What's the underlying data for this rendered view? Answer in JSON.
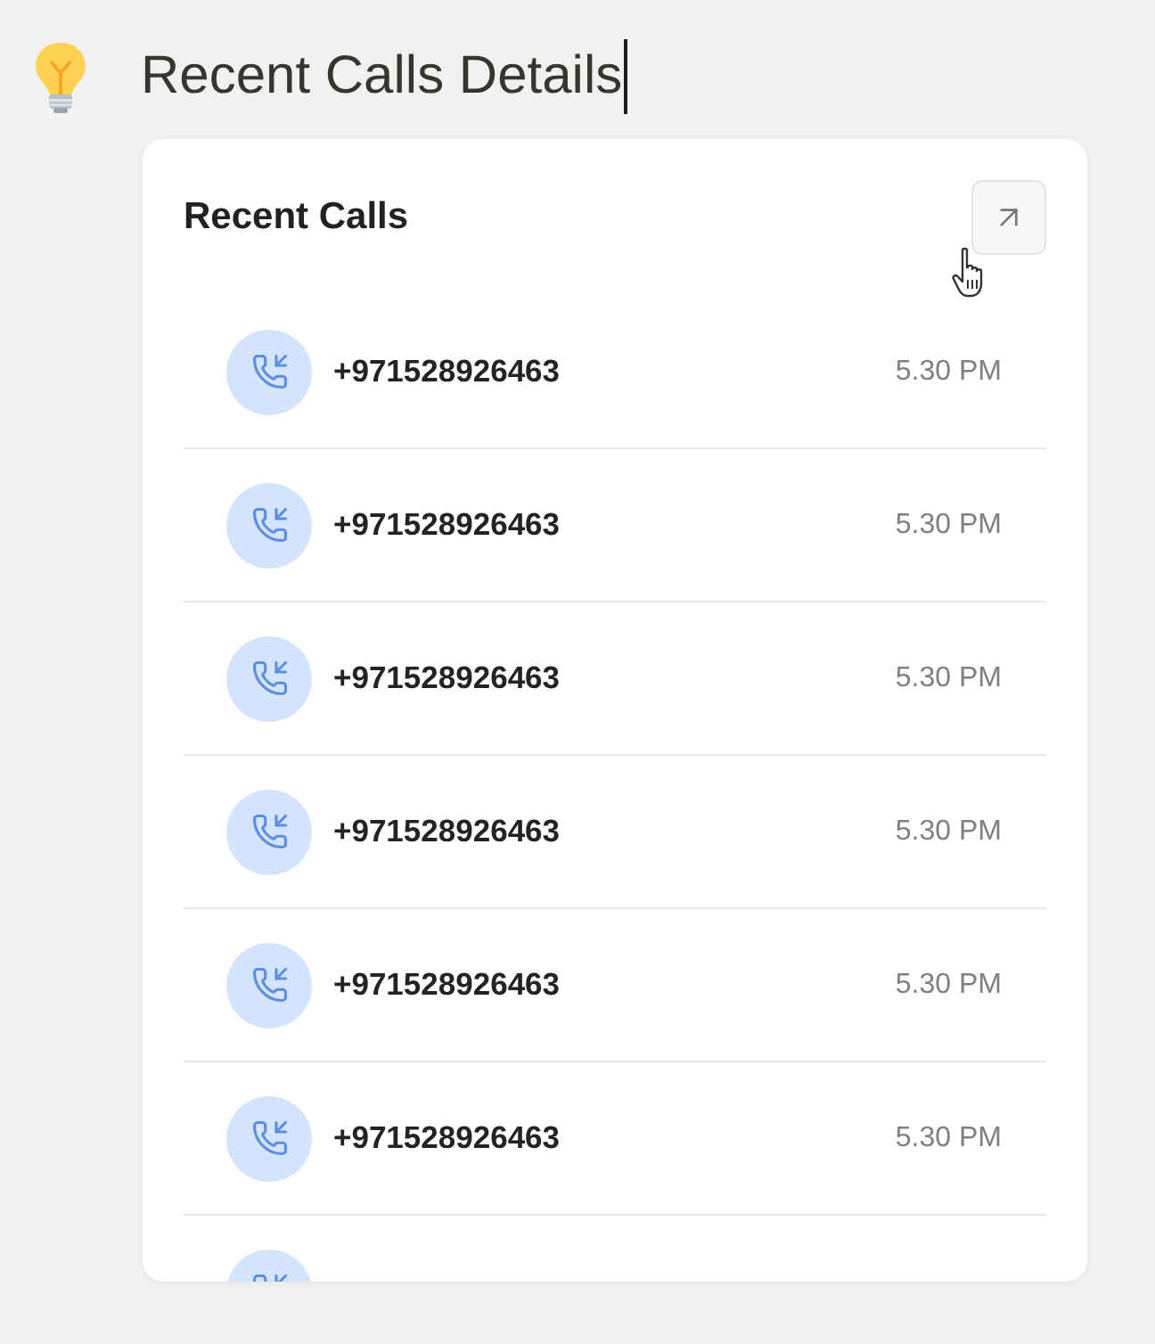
{
  "page_title": "Recent Calls Details",
  "title_editing": true,
  "card": {
    "title": "Recent Calls",
    "calls": [
      {
        "kind": "incoming",
        "number": "+971528926463",
        "time": "5.30 PM"
      },
      {
        "kind": "incoming",
        "number": "+971528926463",
        "time": "5.30 PM"
      },
      {
        "kind": "incoming",
        "number": "+971528926463",
        "time": "5.30 PM"
      },
      {
        "kind": "incoming",
        "number": "+971528926463",
        "time": "5.30 PM"
      },
      {
        "kind": "incoming",
        "number": "+971528926463",
        "time": "5.30 PM"
      },
      {
        "kind": "incoming",
        "number": "+971528926463",
        "time": "5.30 PM"
      },
      {
        "kind": "incoming"
      }
    ]
  }
}
